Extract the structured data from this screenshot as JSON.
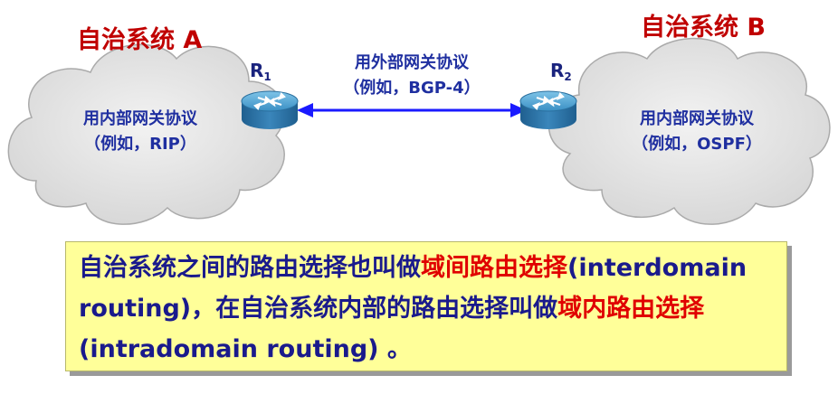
{
  "as_a": {
    "title": "自治系统 A",
    "protocol_line1": "用内部网关协议",
    "protocol_line2": "（例如，RIP）"
  },
  "as_b": {
    "title": "自治系统 B",
    "protocol_line1": "用内部网关协议",
    "protocol_line2": "（例如，OSPF）"
  },
  "link": {
    "line1": "用外部网关协议",
    "line2": "（例如，BGP-4）"
  },
  "routers": [
    {
      "name": "R",
      "sub": "1"
    },
    {
      "name": "R",
      "sub": "2"
    }
  ],
  "note": {
    "part1": "自治系统之间的路由选择也叫做",
    "hl1": "域间路由选择",
    "part2": "(interdomain routing)，在自治系统内部的路由选择叫做",
    "hl2": "域内路由选择",
    "part3": " (intradomain routing) 。"
  },
  "colors": {
    "title_red": "#c00000",
    "text_blue": "#1f2fa0",
    "highlight_red": "#e00000",
    "note_bg": "#ffff99",
    "arrow_blue": "#1a1aff"
  }
}
